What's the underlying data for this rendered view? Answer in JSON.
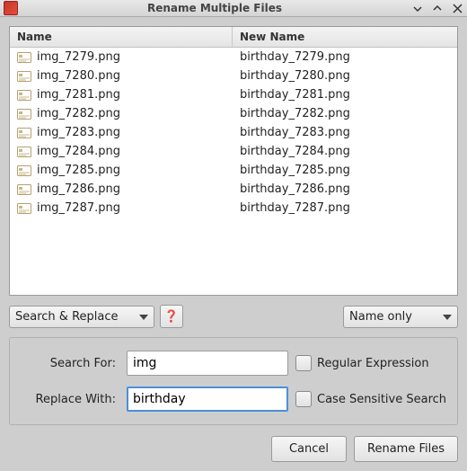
{
  "title": "Rename Multiple Files",
  "columns": {
    "name": "Name",
    "newname": "New Name"
  },
  "files": [
    {
      "name": "img_7279.png",
      "newname": "birthday_7279.png"
    },
    {
      "name": "img_7280.png",
      "newname": "birthday_7280.png"
    },
    {
      "name": "img_7281.png",
      "newname": "birthday_7281.png"
    },
    {
      "name": "img_7282.png",
      "newname": "birthday_7282.png"
    },
    {
      "name": "img_7283.png",
      "newname": "birthday_7283.png"
    },
    {
      "name": "img_7284.png",
      "newname": "birthday_7284.png"
    },
    {
      "name": "img_7285.png",
      "newname": "birthday_7285.png"
    },
    {
      "name": "img_7286.png",
      "newname": "birthday_7286.png"
    },
    {
      "name": "img_7287.png",
      "newname": "birthday_7287.png"
    }
  ],
  "mode_selector": {
    "value": "Search & Replace"
  },
  "scope_selector": {
    "value": "Name only"
  },
  "help_glyph": "❓",
  "form": {
    "search_label": "Search For:",
    "replace_label": "Replace With:",
    "search_value": "img",
    "replace_value": "birthday",
    "regex_label": "Regular Expression",
    "case_label": "Case Sensitive Search",
    "regex_checked": false,
    "case_checked": false
  },
  "buttons": {
    "cancel": "Cancel",
    "rename": "Rename Files"
  }
}
